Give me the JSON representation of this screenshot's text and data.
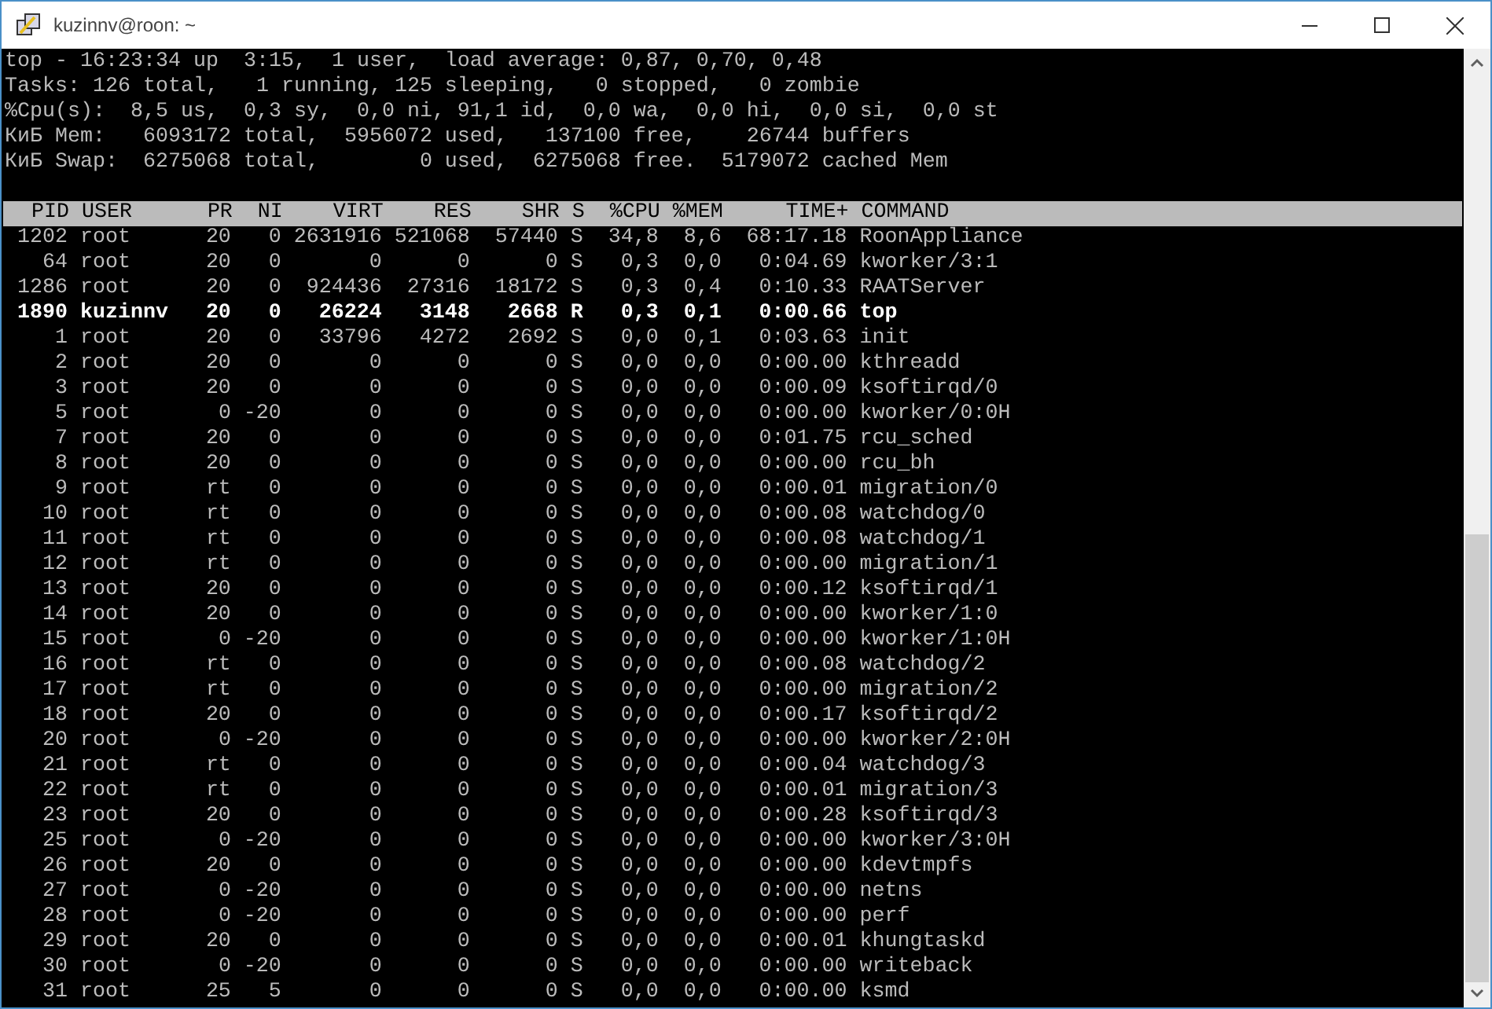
{
  "window": {
    "title": "kuzinnv@roon: ~"
  },
  "summary": [
    "top - 16:23:34 up  3:15,  1 user,  load average: 0,87, 0,70, 0,48",
    "Tasks: 126 total,   1 running, 125 sleeping,   0 stopped,   0 zombie",
    "%Cpu(s):  8,5 us,  0,3 sy,  0,0 ni, 91,1 id,  0,0 wa,  0,0 hi,  0,0 si,  0,0 st",
    "КиБ Mem:   6093172 total,  5956072 used,   137100 free,    26744 buffers",
    "КиБ Swap:  6275068 total,        0 used,  6275068 free.  5179072 cached Mem"
  ],
  "columns": [
    "PID",
    "USER",
    "PR",
    "NI",
    "VIRT",
    "RES",
    "SHR",
    "S",
    "%CPU",
    "%MEM",
    "TIME+",
    "COMMAND"
  ],
  "processes": [
    {
      "cells": [
        "1202",
        "root",
        "20",
        "0",
        "2631916",
        "521068",
        "57440",
        "S",
        "34,8",
        "8,6",
        "68:17.18",
        "RoonAppliance"
      ],
      "bold": false
    },
    {
      "cells": [
        "64",
        "root",
        "20",
        "0",
        "0",
        "0",
        "0",
        "S",
        "0,3",
        "0,0",
        "0:04.69",
        "kworker/3:1"
      ],
      "bold": false
    },
    {
      "cells": [
        "1286",
        "root",
        "20",
        "0",
        "924436",
        "27316",
        "18172",
        "S",
        "0,3",
        "0,4",
        "0:10.33",
        "RAATServer"
      ],
      "bold": false
    },
    {
      "cells": [
        "1890",
        "kuzinnv",
        "20",
        "0",
        "26224",
        "3148",
        "2668",
        "R",
        "0,3",
        "0,1",
        "0:00.66",
        "top"
      ],
      "bold": true
    },
    {
      "cells": [
        "1",
        "root",
        "20",
        "0",
        "33796",
        "4272",
        "2692",
        "S",
        "0,0",
        "0,1",
        "0:03.63",
        "init"
      ],
      "bold": false
    },
    {
      "cells": [
        "2",
        "root",
        "20",
        "0",
        "0",
        "0",
        "0",
        "S",
        "0,0",
        "0,0",
        "0:00.00",
        "kthreadd"
      ],
      "bold": false
    },
    {
      "cells": [
        "3",
        "root",
        "20",
        "0",
        "0",
        "0",
        "0",
        "S",
        "0,0",
        "0,0",
        "0:00.09",
        "ksoftirqd/0"
      ],
      "bold": false
    },
    {
      "cells": [
        "5",
        "root",
        "0",
        "-20",
        "0",
        "0",
        "0",
        "S",
        "0,0",
        "0,0",
        "0:00.00",
        "kworker/0:0H"
      ],
      "bold": false
    },
    {
      "cells": [
        "7",
        "root",
        "20",
        "0",
        "0",
        "0",
        "0",
        "S",
        "0,0",
        "0,0",
        "0:01.75",
        "rcu_sched"
      ],
      "bold": false
    },
    {
      "cells": [
        "8",
        "root",
        "20",
        "0",
        "0",
        "0",
        "0",
        "S",
        "0,0",
        "0,0",
        "0:00.00",
        "rcu_bh"
      ],
      "bold": false
    },
    {
      "cells": [
        "9",
        "root",
        "rt",
        "0",
        "0",
        "0",
        "0",
        "S",
        "0,0",
        "0,0",
        "0:00.01",
        "migration/0"
      ],
      "bold": false
    },
    {
      "cells": [
        "10",
        "root",
        "rt",
        "0",
        "0",
        "0",
        "0",
        "S",
        "0,0",
        "0,0",
        "0:00.08",
        "watchdog/0"
      ],
      "bold": false
    },
    {
      "cells": [
        "11",
        "root",
        "rt",
        "0",
        "0",
        "0",
        "0",
        "S",
        "0,0",
        "0,0",
        "0:00.08",
        "watchdog/1"
      ],
      "bold": false
    },
    {
      "cells": [
        "12",
        "root",
        "rt",
        "0",
        "0",
        "0",
        "0",
        "S",
        "0,0",
        "0,0",
        "0:00.00",
        "migration/1"
      ],
      "bold": false
    },
    {
      "cells": [
        "13",
        "root",
        "20",
        "0",
        "0",
        "0",
        "0",
        "S",
        "0,0",
        "0,0",
        "0:00.12",
        "ksoftirqd/1"
      ],
      "bold": false
    },
    {
      "cells": [
        "14",
        "root",
        "20",
        "0",
        "0",
        "0",
        "0",
        "S",
        "0,0",
        "0,0",
        "0:00.00",
        "kworker/1:0"
      ],
      "bold": false
    },
    {
      "cells": [
        "15",
        "root",
        "0",
        "-20",
        "0",
        "0",
        "0",
        "S",
        "0,0",
        "0,0",
        "0:00.00",
        "kworker/1:0H"
      ],
      "bold": false
    },
    {
      "cells": [
        "16",
        "root",
        "rt",
        "0",
        "0",
        "0",
        "0",
        "S",
        "0,0",
        "0,0",
        "0:00.08",
        "watchdog/2"
      ],
      "bold": false
    },
    {
      "cells": [
        "17",
        "root",
        "rt",
        "0",
        "0",
        "0",
        "0",
        "S",
        "0,0",
        "0,0",
        "0:00.00",
        "migration/2"
      ],
      "bold": false
    },
    {
      "cells": [
        "18",
        "root",
        "20",
        "0",
        "0",
        "0",
        "0",
        "S",
        "0,0",
        "0,0",
        "0:00.17",
        "ksoftirqd/2"
      ],
      "bold": false
    },
    {
      "cells": [
        "20",
        "root",
        "0",
        "-20",
        "0",
        "0",
        "0",
        "S",
        "0,0",
        "0,0",
        "0:00.00",
        "kworker/2:0H"
      ],
      "bold": false
    },
    {
      "cells": [
        "21",
        "root",
        "rt",
        "0",
        "0",
        "0",
        "0",
        "S",
        "0,0",
        "0,0",
        "0:00.04",
        "watchdog/3"
      ],
      "bold": false
    },
    {
      "cells": [
        "22",
        "root",
        "rt",
        "0",
        "0",
        "0",
        "0",
        "S",
        "0,0",
        "0,0",
        "0:00.01",
        "migration/3"
      ],
      "bold": false
    },
    {
      "cells": [
        "23",
        "root",
        "20",
        "0",
        "0",
        "0",
        "0",
        "S",
        "0,0",
        "0,0",
        "0:00.28",
        "ksoftirqd/3"
      ],
      "bold": false
    },
    {
      "cells": [
        "25",
        "root",
        "0",
        "-20",
        "0",
        "0",
        "0",
        "S",
        "0,0",
        "0,0",
        "0:00.00",
        "kworker/3:0H"
      ],
      "bold": false
    },
    {
      "cells": [
        "26",
        "root",
        "20",
        "0",
        "0",
        "0",
        "0",
        "S",
        "0,0",
        "0,0",
        "0:00.00",
        "kdevtmpfs"
      ],
      "bold": false
    },
    {
      "cells": [
        "27",
        "root",
        "0",
        "-20",
        "0",
        "0",
        "0",
        "S",
        "0,0",
        "0,0",
        "0:00.00",
        "netns"
      ],
      "bold": false
    },
    {
      "cells": [
        "28",
        "root",
        "0",
        "-20",
        "0",
        "0",
        "0",
        "S",
        "0,0",
        "0,0",
        "0:00.00",
        "perf"
      ],
      "bold": false
    },
    {
      "cells": [
        "29",
        "root",
        "20",
        "0",
        "0",
        "0",
        "0",
        "S",
        "0,0",
        "0,0",
        "0:00.01",
        "khungtaskd"
      ],
      "bold": false
    },
    {
      "cells": [
        "30",
        "root",
        "0",
        "-20",
        "0",
        "0",
        "0",
        "S",
        "0,0",
        "0,0",
        "0:00.00",
        "writeback"
      ],
      "bold": false
    },
    {
      "cells": [
        "31",
        "root",
        "25",
        "5",
        "0",
        "0",
        "0",
        "S",
        "0,0",
        "0,0",
        "0:00.00",
        "ksmd"
      ],
      "bold": false
    }
  ]
}
